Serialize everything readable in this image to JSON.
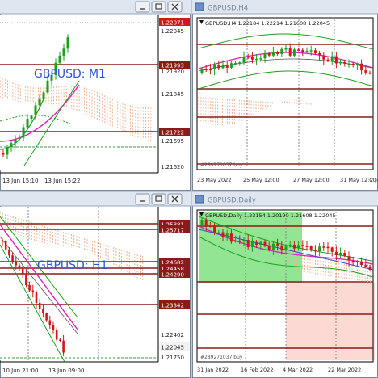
{
  "windows": [
    {
      "title": "",
      "caption": "GBPUSD: M1",
      "ohlc_header": "",
      "price_ticks": [
        "1.22071",
        "1.22045",
        "1.21993",
        "1.21920",
        "1.21845",
        "1.21722",
        "1.21695",
        "1.21620"
      ],
      "time_ticks": [
        "13 Jun 15:10",
        "13 Jun 15:22"
      ],
      "current_price_label": "1.22071"
    },
    {
      "title": "GBPUSD,H4",
      "caption": "",
      "ohlc_header": "GBPUSD,H4  1.22184 1.22214 1.21608 1.22045",
      "price_ticks": [],
      "time_ticks": [
        "23 May 2022",
        "25 May 12:00",
        "27 May 12:00",
        "31 May 12:00",
        "2 Ju"
      ],
      "order_label": "#289271037 buy"
    },
    {
      "title": "",
      "caption": "GBPUSD: H1",
      "ohlc_header": "",
      "price_ticks": [
        "1.25881",
        "1.25717",
        "1.24682",
        "1.24458",
        "1.24290",
        "1.23342",
        "1.22402",
        "1.22045",
        "1.21750"
      ],
      "time_ticks": [
        "10 Jun 21:00",
        "13 Jun 09:00"
      ],
      "current_price_label": "1.22045"
    },
    {
      "title": "GBPUSD,Daily",
      "caption": "",
      "ohlc_header": "GBPUSD,Daily  1.23154 1.20190 1.21608 1.22045",
      "price_ticks": [],
      "time_ticks": [
        "31 Jan 2022",
        "16 Feb 2022",
        "4 Mar 2022",
        "22 Mar 2022"
      ],
      "order_label": "#289271037 buy"
    }
  ],
  "chart_data": [
    {
      "type": "candlestick",
      "title": "GBPUSD: M1",
      "ylim": [
        1.2158,
        1.221
      ],
      "x": [
        "13 Jun 15:10",
        "13 Jun 15:22"
      ],
      "candles_close": [
        1.2162,
        1.2166,
        1.2168,
        1.2173,
        1.217,
        1.2175,
        1.2178,
        1.2176,
        1.2182,
        1.2186,
        1.219,
        1.2194,
        1.2199,
        1.2203,
        1.2206
      ],
      "horizontal_lines": [
        1.22071,
        1.22045,
        1.21933,
        1.21722
      ],
      "colors": {
        "bull": "#1aa01a",
        "bear": "#d01818",
        "ma_fast": "#e020c0",
        "ma_slow": "#1aa01a",
        "cloud": "#f0a878"
      }
    },
    {
      "type": "candlestick",
      "title": "GBPUSD,H4",
      "x": [
        "23 May 2022",
        "25 May 12:00",
        "27 May 12:00",
        "31 May 12:00"
      ],
      "ohlc": [
        1.22184,
        1.22214,
        1.21608,
        1.22045
      ]
    },
    {
      "type": "candlestick",
      "title": "GBPUSD: H1",
      "ylim": [
        1.217,
        1.26
      ],
      "x": [
        "10 Jun 21:00",
        "13 Jun 09:00"
      ],
      "horizontal_lines": [
        1.25881,
        1.25717,
        1.24682,
        1.24458,
        1.2429,
        1.23342,
        1.22045
      ]
    },
    {
      "type": "candlestick",
      "title": "GBPUSD,Daily",
      "x": [
        "31 Jan 2022",
        "16 Feb 2022",
        "4 Mar 2022",
        "22 Mar 2022"
      ],
      "ohlc": [
        1.23154,
        1.2019,
        1.21608,
        1.22045
      ],
      "zones": [
        {
          "color": "#7fe07f"
        },
        {
          "color": "#fcd9d2"
        }
      ]
    }
  ]
}
